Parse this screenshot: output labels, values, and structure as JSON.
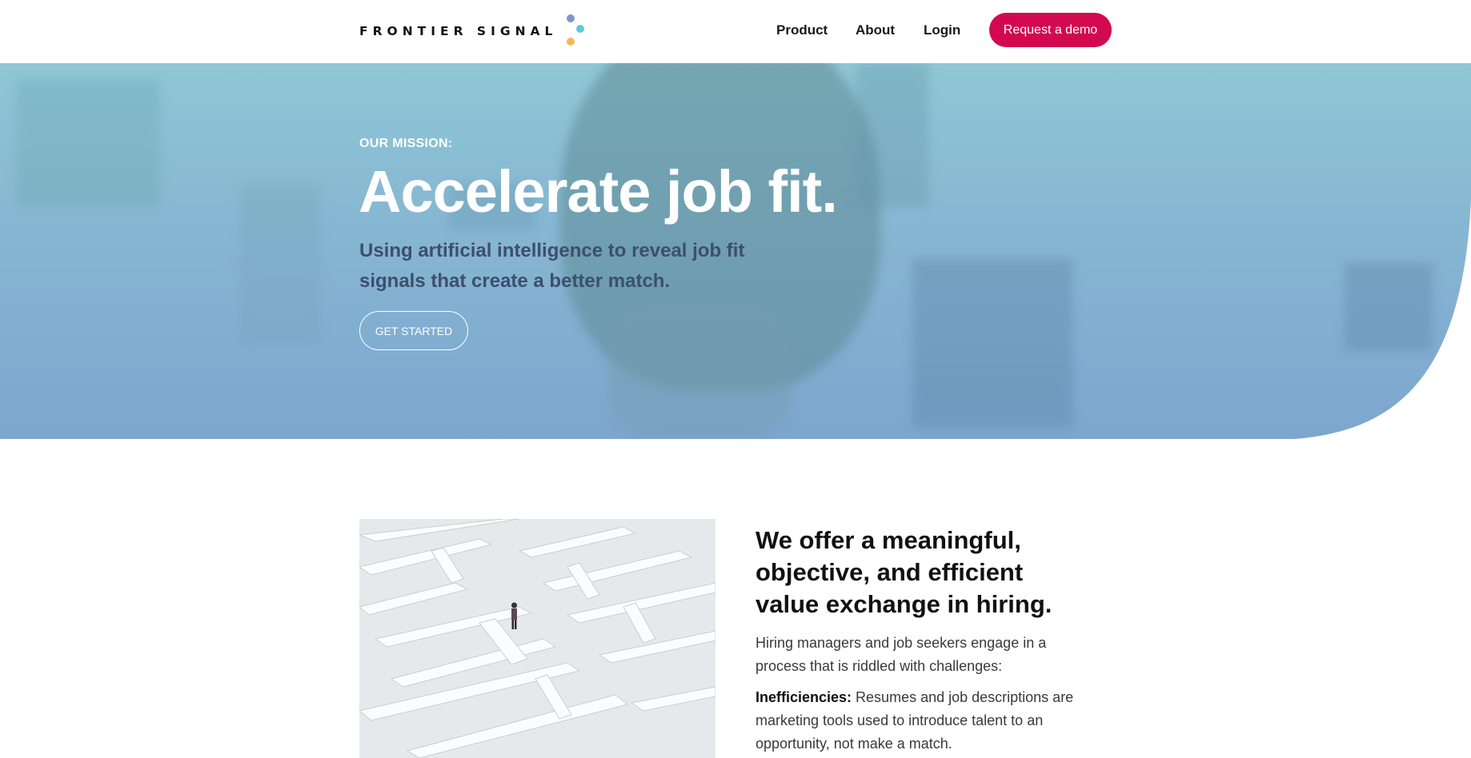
{
  "header": {
    "logo_text": "FRONTIER SIGNAL",
    "nav": [
      "Product",
      "About",
      "Login"
    ],
    "demo_button": "Request a demo"
  },
  "hero": {
    "eyebrow": "OUR MISSION:",
    "title": "Accelerate job fit.",
    "subtitle": "Using artificial intelligence to reveal job fit signals that create a better match.",
    "cta": "GET STARTED"
  },
  "offer": {
    "title": "We offer a meaningful, objective, and efficient value exchange in hiring.",
    "intro": "Hiring managers and job seekers engage in a process that is riddled with challenges:",
    "points": [
      {
        "label": "Inefficiencies:",
        "text": " Resumes and job descriptions are marketing tools used to introduce talent to an opportunity, not make a match."
      }
    ]
  },
  "colors": {
    "accent": "#d3094f",
    "logo_dots": [
      "#7d97c9",
      "#5ccadb",
      "#f0b858"
    ],
    "hero_gradient_top": "#8fc7d6",
    "hero_gradient_bottom": "#7da6cf"
  }
}
